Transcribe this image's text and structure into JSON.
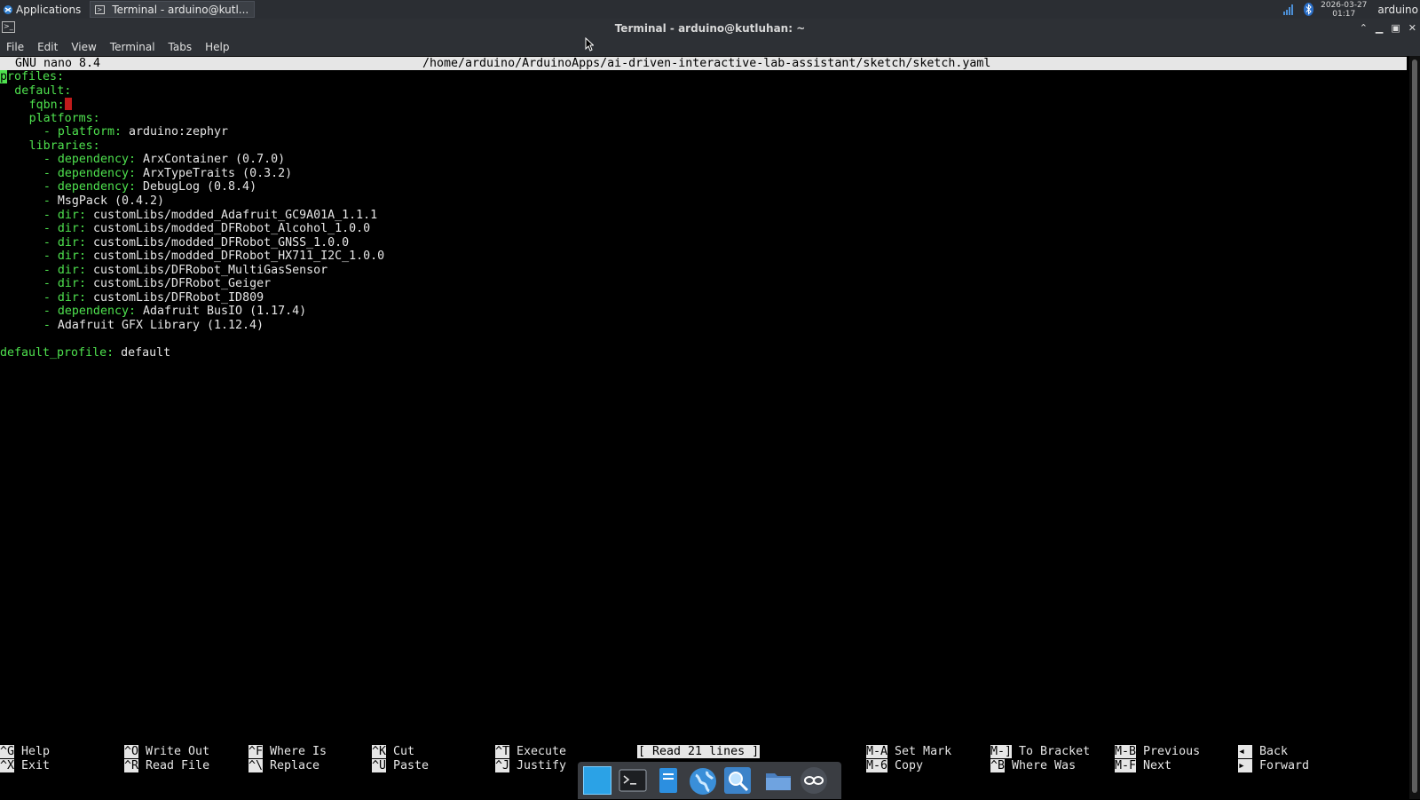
{
  "panel": {
    "applications_label": "Applications",
    "task_label": "Terminal - arduino@kutl...",
    "date": "2026-03-27",
    "time": "01:17",
    "user": "arduino"
  },
  "window": {
    "title": "Terminal - arduino@kutluhan: ~"
  },
  "menu": [
    "File",
    "Edit",
    "View",
    "Terminal",
    "Tabs",
    "Help"
  ],
  "nano": {
    "version": "GNU nano 8.4",
    "path": "/home/arduino/ArduinoApps/ai-driven-interactive-lab-assistant/sketch/sketch.yaml",
    "status": "[ Read 21 lines ]"
  },
  "file_lines": [
    {
      "key": "profiles",
      "sep": ":",
      "value": ""
    },
    {
      "key": "default",
      "sep": ":",
      "value": ""
    },
    {
      "key": "fqbn",
      "sep": ":",
      "value": ""
    },
    {
      "key": "platforms",
      "sep": ":",
      "value": ""
    },
    {
      "key": "platform",
      "sep": ": ",
      "value": "arduino:zephyr"
    },
    {
      "key": "libraries",
      "sep": ":",
      "value": ""
    },
    {
      "key": "dependency",
      "sep": ": ",
      "value": "ArxContainer (0.7.0)"
    },
    {
      "key": "dependency",
      "sep": ": ",
      "value": "ArxTypeTraits (0.3.2)"
    },
    {
      "key": "dependency",
      "sep": ": ",
      "value": "DebugLog (0.8.4)"
    },
    {
      "key": "",
      "sep": "",
      "value": "MsgPack (0.4.2)"
    },
    {
      "key": "dir",
      "sep": ": ",
      "value": "customLibs/modded_Adafruit_GC9A01A_1.1.1"
    },
    {
      "key": "dir",
      "sep": ": ",
      "value": "customLibs/modded_DFRobot_Alcohol_1.0.0"
    },
    {
      "key": "dir",
      "sep": ": ",
      "value": "customLibs/modded_DFRobot_GNSS_1.0.0"
    },
    {
      "key": "dir",
      "sep": ": ",
      "value": "customLibs/modded_DFRobot_HX711_I2C_1.0.0"
    },
    {
      "key": "dir",
      "sep": ": ",
      "value": "customLibs/DFRobot_MultiGasSensor"
    },
    {
      "key": "dir",
      "sep": ": ",
      "value": "customLibs/DFRobot_Geiger"
    },
    {
      "key": "dir",
      "sep": ": ",
      "value": "customLibs/DFRobot_ID809"
    },
    {
      "key": "dependency",
      "sep": ": ",
      "value": "Adafruit BusIO (1.17.4)"
    },
    {
      "key": "",
      "sep": "",
      "value": "Adafruit GFX Library (1.12.4)"
    },
    {
      "key": "",
      "sep": "",
      "value": ""
    },
    {
      "key": "default_profile",
      "sep": ": ",
      "value": "default"
    }
  ],
  "shortcuts": [
    {
      "key": "^G",
      "label": "Help"
    },
    {
      "key": "^X",
      "label": "Exit"
    },
    {
      "key": "^O",
      "label": "Write Out"
    },
    {
      "key": "^R",
      "label": "Read File"
    },
    {
      "key": "^F",
      "label": "Where Is"
    },
    {
      "key": "^\\",
      "label": "Replace"
    },
    {
      "key": "^K",
      "label": "Cut"
    },
    {
      "key": "^U",
      "label": "Paste"
    },
    {
      "key": "^T",
      "label": "Execute"
    },
    {
      "key": "^J",
      "label": "Justify"
    },
    {
      "key": "M-A",
      "label": "Set Mark"
    },
    {
      "key": "M-6",
      "label": "Copy"
    },
    {
      "key": "M-]",
      "label": "To Bracket"
    },
    {
      "key": "^B",
      "label": "Where Was"
    },
    {
      "key": "M-B",
      "label": "Previous"
    },
    {
      "key": "M-F",
      "label": "Next"
    },
    {
      "key": "◂",
      "label": "Back"
    },
    {
      "key": "▸",
      "label": "Forward"
    }
  ],
  "dock_icons": [
    "desktop-icon",
    "terminal-icon",
    "file-manager-icon",
    "web-browser-icon",
    "search-icon",
    "folder-icon",
    "arduino-icon"
  ],
  "colors": {
    "yaml_key": "#4ee14e",
    "panel_bg": "#2b2e33",
    "cursor_error": "#c01b1b"
  }
}
